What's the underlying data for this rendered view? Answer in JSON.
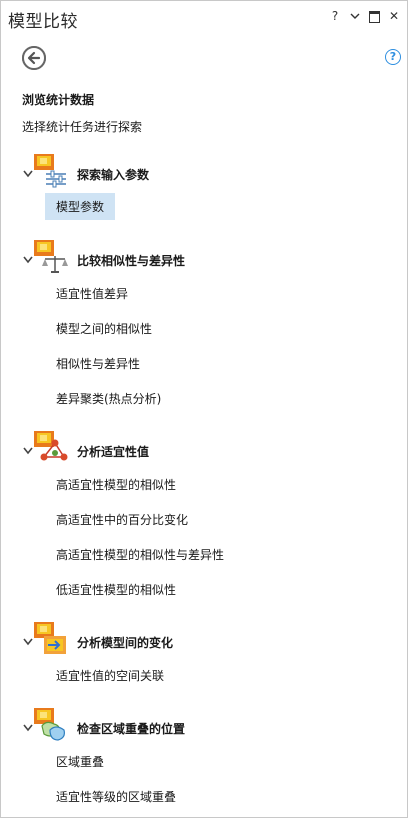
{
  "window": {
    "title": "模型比较",
    "help_glyph": "?",
    "dropdown_glyph": "⌄",
    "close_glyph": "✕"
  },
  "nav": {
    "help_label": "?"
  },
  "intro": {
    "heading": "浏览统计数据",
    "subheading": "选择统计任务进行探索"
  },
  "groups": [
    {
      "title": "探索输入参数",
      "icon": "sliders-icon",
      "items": [
        {
          "label": "模型参数",
          "selected": true
        }
      ]
    },
    {
      "title": "比较相似性与差异性",
      "icon": "balance-scale-icon",
      "items": [
        {
          "label": "适宜性值差异"
        },
        {
          "label": "模型之间的相似性"
        },
        {
          "label": "相似性与差异性"
        },
        {
          "label": "差异聚类(热点分析)"
        }
      ]
    },
    {
      "title": "分析适宜性值",
      "icon": "network-icon",
      "items": [
        {
          "label": "高适宜性模型的相似性"
        },
        {
          "label": "高适宜性中的百分比变化"
        },
        {
          "label": "高适宜性模型的相似性与差异性"
        },
        {
          "label": "低适宜性模型的相似性"
        }
      ]
    },
    {
      "title": "分析模型间的变化",
      "icon": "change-arrow-icon",
      "items": [
        {
          "label": "适宜性值的空间关联"
        }
      ]
    },
    {
      "title": "检查区域重叠的位置",
      "icon": "overlap-icon",
      "items": [
        {
          "label": "区域重叠"
        },
        {
          "label": "适宜性等级的区域重叠"
        }
      ]
    }
  ],
  "colors": {
    "accent": "#2f8fe0",
    "selection": "#cfe3f4",
    "raster_icon_orange": "#e87a1c",
    "raster_icon_yellow": "#f7c623"
  }
}
